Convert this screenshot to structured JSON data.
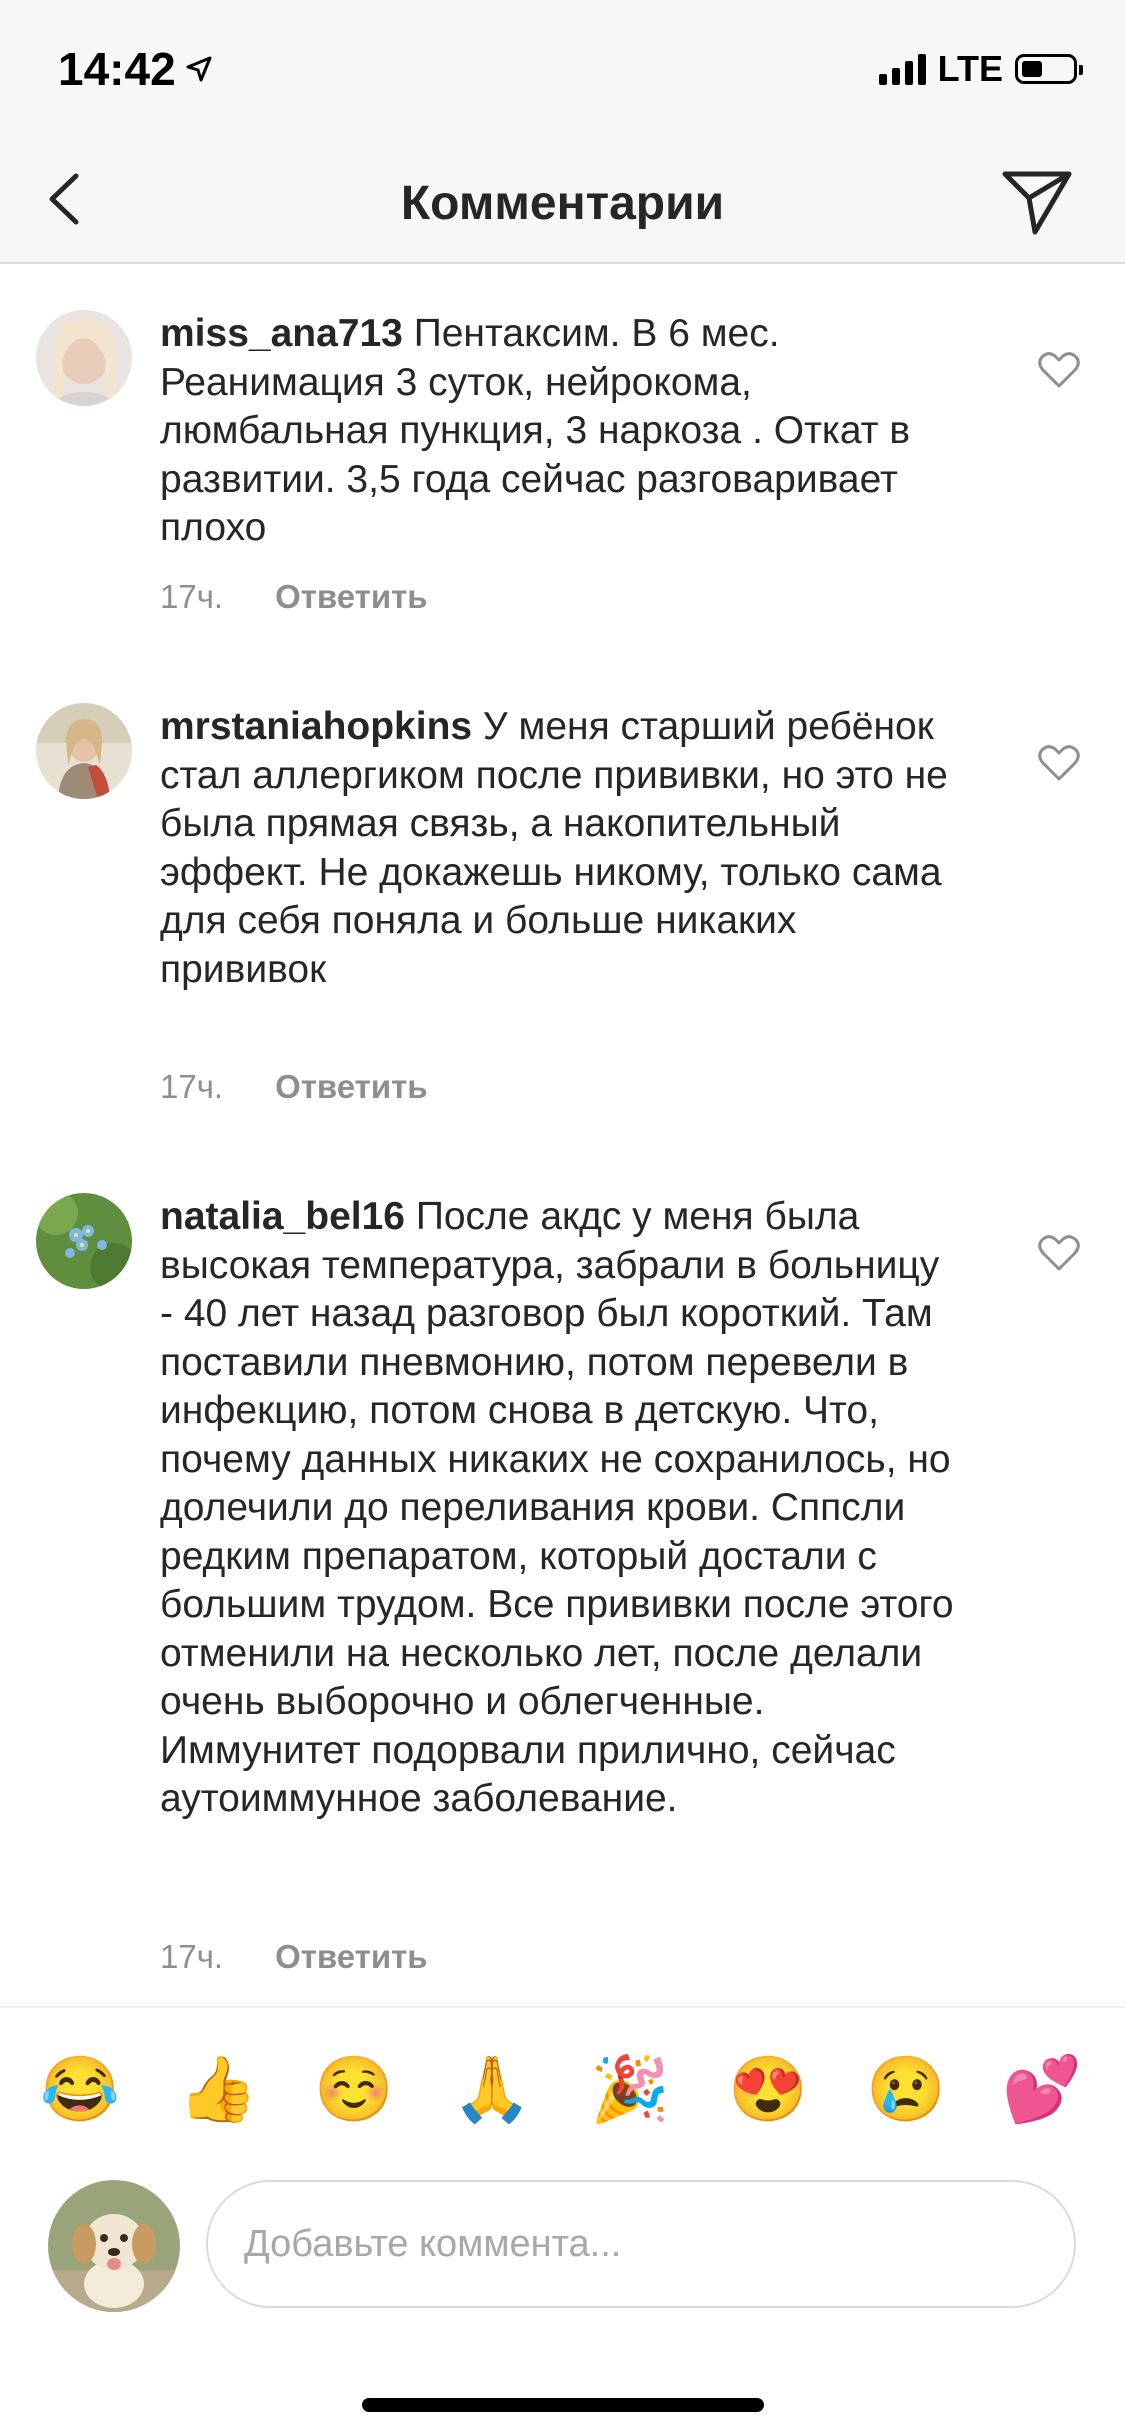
{
  "status_bar": {
    "time": "14:42",
    "network": "LTE"
  },
  "header": {
    "title": "Комментарии"
  },
  "comments": [
    {
      "username": "miss_ana713",
      "text": "Пентаксим. В 6 мес. Реанимация 3 суток, нейрокома, люмбальная пункция, 3 наркоза . Откат в развитии. 3,5 года сейчас разговаривает плохо",
      "time": "17ч.",
      "reply": "Ответить"
    },
    {
      "username": "mrstaniahopkins",
      "text": "У меня старший ребёнок стал аллергиком после прививки, но это не была прямая связь, а накопительный эффект. Не докажешь никому, только сама для себя поняла и больше никаких прививок",
      "time": "17ч.",
      "reply": "Ответить"
    },
    {
      "username": "natalia_bel16",
      "text": "После акдс у меня была высокая температура, забрали в больницу - 40 лет назад разговор был короткий. Там поставили пневмонию, потом перевели в инфекцию, потом снова в детскую. Что, почему данных никаких не сохранилось, но долечили до переливания крови. Сппсли редким препаратом, который достали с большим трудом. Все прививки после этого отменили на несколько лет, после делали очень выборочно и облегченные. Иммунитет подорвали прилично, сейчас аутоиммунное заболевание.",
      "time": "17ч.",
      "reply": "Ответить"
    }
  ],
  "emoji_bar": [
    "😂",
    "👍",
    "☺️",
    "🙏",
    "🎉",
    "😍",
    "😢",
    "💕"
  ],
  "composer": {
    "placeholder": "Добавьте коммента..."
  },
  "colors": {
    "heart": "#8e8e8e",
    "meta": "#8e8e8e",
    "text": "#262626"
  }
}
